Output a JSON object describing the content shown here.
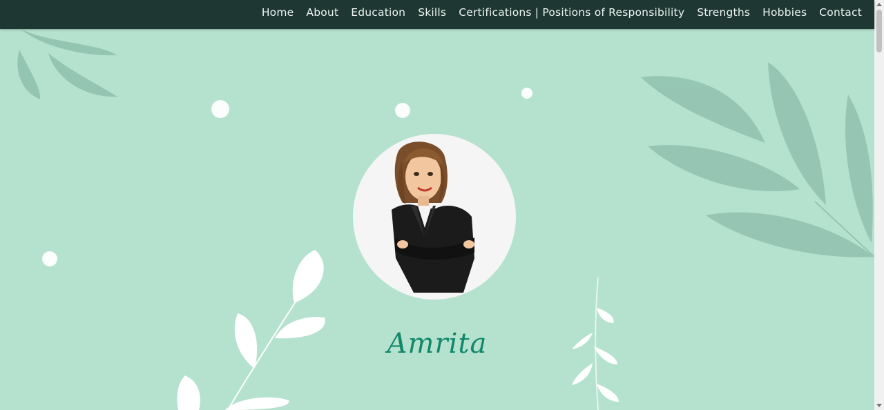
{
  "nav": {
    "items": [
      {
        "label": "Home",
        "name": "nav-home"
      },
      {
        "label": "About",
        "name": "nav-about"
      },
      {
        "label": "Education",
        "name": "nav-education"
      },
      {
        "label": "Skills",
        "name": "nav-skills"
      },
      {
        "label": "Certifications | Positions of Responsibility",
        "name": "nav-certifications"
      },
      {
        "label": "Strengths",
        "name": "nav-strengths"
      },
      {
        "label": "Hobbies",
        "name": "nav-hobbies"
      },
      {
        "label": "Contact",
        "name": "nav-contact"
      }
    ]
  },
  "hero": {
    "name": "Amrita",
    "avatar_icon": "businesswoman-avatar-icon"
  },
  "colors": {
    "navbar": "#1e3732",
    "background": "#b4e2cf",
    "name_text": "#12876a"
  }
}
